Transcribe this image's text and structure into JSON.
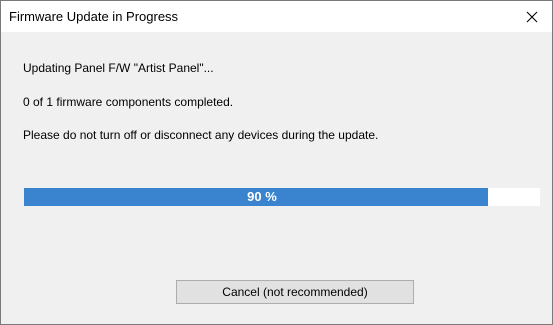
{
  "window": {
    "title": "Firmware Update in Progress",
    "close_icon": "close-icon"
  },
  "messages": {
    "updating": "Updating Panel F/W \"Artist Panel\"...",
    "components": "0 of 1 firmware components completed.",
    "warning": "Please do not turn off or disconnect any devices during the update."
  },
  "progress": {
    "percent": 90,
    "label": "90 %",
    "color": "#3a83cf"
  },
  "buttons": {
    "cancel_label": "Cancel (not recommended)"
  }
}
